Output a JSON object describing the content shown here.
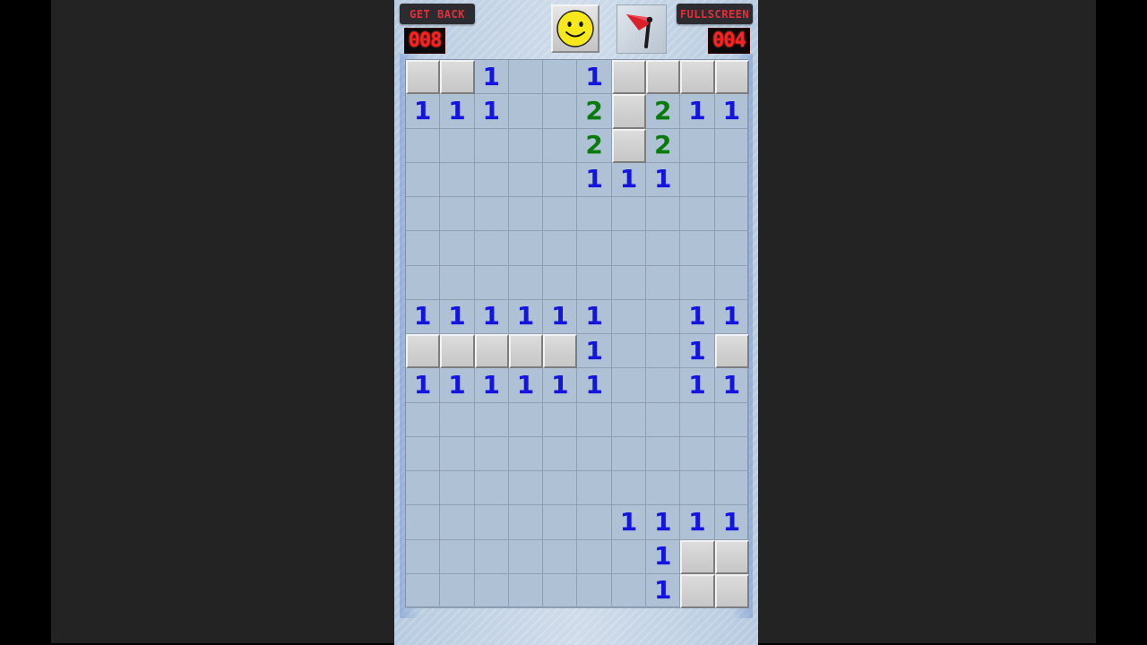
{
  "header": {
    "get_back_label": "GET BACK",
    "fullscreen_label": "FULLSCREEN",
    "mines_counter": "008",
    "timer": "004",
    "face_icon": "smiley-face-icon",
    "flag_icon": "flag-icon"
  },
  "board": {
    "cols": 10,
    "rows": 16,
    "legend": "H = unrevealed tile, 0 = empty revealed tile, digit = adjacent mine count",
    "cells": [
      [
        "H",
        "H",
        "1",
        "0",
        "0",
        "1",
        "H",
        "H",
        "H",
        "H"
      ],
      [
        "1",
        "1",
        "1",
        "0",
        "0",
        "2",
        "H",
        "2",
        "1",
        "1"
      ],
      [
        "0",
        "0",
        "0",
        "0",
        "0",
        "2",
        "H",
        "2",
        "0",
        "0"
      ],
      [
        "0",
        "0",
        "0",
        "0",
        "0",
        "1",
        "1",
        "1",
        "0",
        "0"
      ],
      [
        "0",
        "0",
        "0",
        "0",
        "0",
        "0",
        "0",
        "0",
        "0",
        "0"
      ],
      [
        "0",
        "0",
        "0",
        "0",
        "0",
        "0",
        "0",
        "0",
        "0",
        "0"
      ],
      [
        "0",
        "0",
        "0",
        "0",
        "0",
        "0",
        "0",
        "0",
        "0",
        "0"
      ],
      [
        "1",
        "1",
        "1",
        "1",
        "1",
        "1",
        "0",
        "0",
        "1",
        "1"
      ],
      [
        "H",
        "H",
        "H",
        "H",
        "H",
        "1",
        "0",
        "0",
        "1",
        "H"
      ],
      [
        "1",
        "1",
        "1",
        "1",
        "1",
        "1",
        "0",
        "0",
        "1",
        "1"
      ],
      [
        "0",
        "0",
        "0",
        "0",
        "0",
        "0",
        "0",
        "0",
        "0",
        "0"
      ],
      [
        "0",
        "0",
        "0",
        "0",
        "0",
        "0",
        "0",
        "0",
        "0",
        "0"
      ],
      [
        "0",
        "0",
        "0",
        "0",
        "0",
        "0",
        "0",
        "0",
        "0",
        "0"
      ],
      [
        "0",
        "0",
        "0",
        "0",
        "0",
        "0",
        "1",
        "1",
        "1",
        "1"
      ],
      [
        "0",
        "0",
        "0",
        "0",
        "0",
        "0",
        "0",
        "1",
        "H",
        "H"
      ],
      [
        "0",
        "0",
        "0",
        "0",
        "0",
        "0",
        "0",
        "1",
        "H",
        "H"
      ]
    ]
  },
  "colors": {
    "number_1": "#1414e0",
    "number_2": "#0a7a0a",
    "counter_digits": "#ff2020",
    "button_text": "#e0303a"
  }
}
